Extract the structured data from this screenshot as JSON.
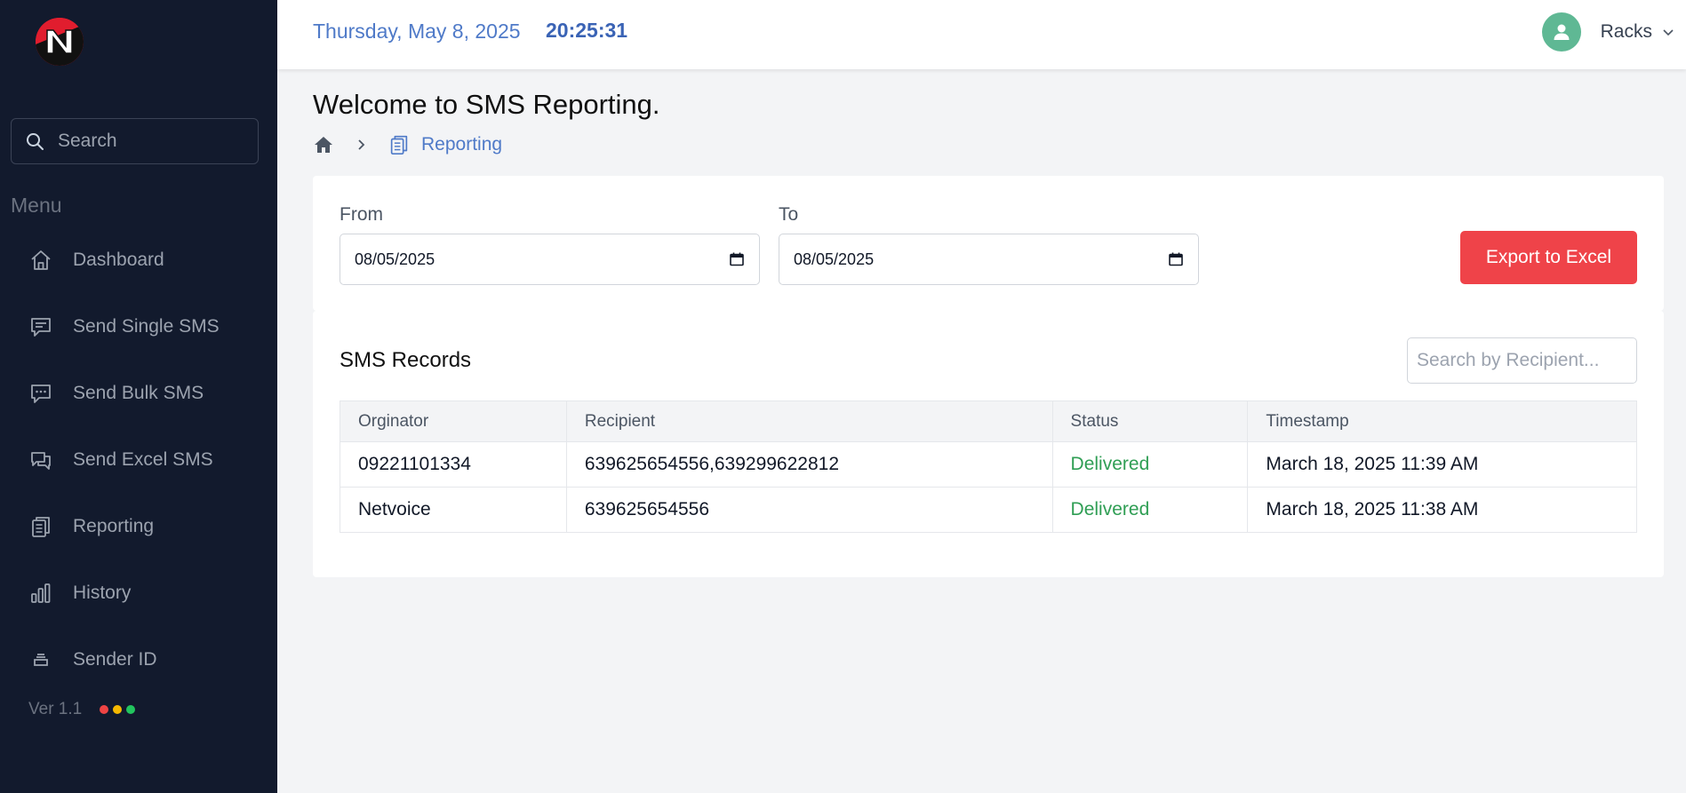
{
  "sidebar": {
    "search_label": "Search",
    "menu_title": "Menu",
    "items": [
      {
        "label": "Dashboard",
        "icon": "home-outline-icon"
      },
      {
        "label": "Send Single SMS",
        "icon": "chat-lines-icon"
      },
      {
        "label": "Send Bulk SMS",
        "icon": "chat-dots-icon"
      },
      {
        "label": "Send Excel SMS",
        "icon": "chat-double-icon"
      },
      {
        "label": "Reporting",
        "icon": "clipboard-list-icon"
      },
      {
        "label": "History",
        "icon": "bar-chart-icon"
      },
      {
        "label": "Sender ID",
        "icon": "stack-icon"
      }
    ],
    "version": "Ver 1.1"
  },
  "header": {
    "date": "Thursday, May 8, 2025",
    "time": "20:25:31",
    "username": "Racks"
  },
  "page": {
    "title": "Welcome to SMS Reporting.",
    "breadcrumb": {
      "current": "Reporting"
    }
  },
  "filters": {
    "from_label": "From",
    "from_value": "08/05/2025",
    "to_label": "To",
    "to_value": "08/05/2025",
    "export_label": "Export to Excel"
  },
  "records": {
    "title": "SMS Records",
    "search_placeholder": "Search by Recipient...",
    "columns": [
      "Orginator",
      "Recipient",
      "Status",
      "Timestamp"
    ],
    "rows": [
      [
        "09221101334",
        "639625654556,639299622812",
        "Delivered",
        "March 18, 2025 11:39 AM"
      ],
      [
        "Netvoice",
        "639625654556",
        "Delivered",
        "March 18, 2025 11:38 AM"
      ]
    ]
  },
  "colors": {
    "sidebar_bg": "#121a2d",
    "accent_blue": "#4f7ac8",
    "export_red": "#ef4349",
    "delivered_green": "#2f9e54",
    "avatar_green": "#5fb894",
    "status_dots": [
      "#ef4444",
      "#f5b800",
      "#22c55e"
    ]
  }
}
